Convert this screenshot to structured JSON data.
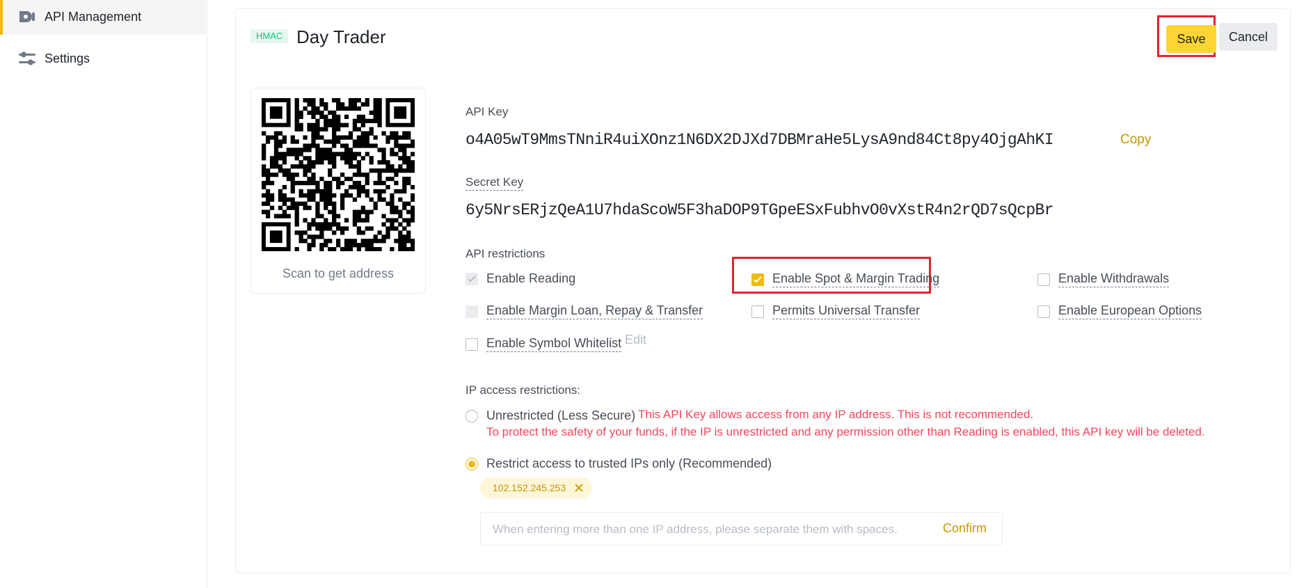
{
  "sidebar": {
    "items": [
      {
        "label": "API Management",
        "icon": "api-icon"
      },
      {
        "label": "Settings",
        "icon": "sliders-icon"
      }
    ]
  },
  "api": {
    "badge": "HMAC",
    "name": "Day Trader",
    "save_label": "Save",
    "cancel_label": "Cancel",
    "qr_caption": "Scan to get address",
    "api_key_label": "API Key",
    "api_key": "o4A05wT9MmsTNniR4uiXOnz1N6DX2DJXd7DBMraHe5LysA9nd84Ct8py4OjgAhKI",
    "copy_label": "Copy",
    "secret_key_label": "Secret Key",
    "secret_key": "6y5NrsERjzQeA1U7hdaScoW5F3haDOP9TGpeESxFubhvO0vXstR4n2rQD7sQcpBr"
  },
  "restrictions": {
    "label": "API restrictions",
    "enable_reading": "Enable Reading",
    "enable_spot_margin": "Enable Spot & Margin Trading",
    "enable_withdrawals": "Enable Withdrawals",
    "enable_margin_loan": "Enable Margin Loan, Repay & Transfer",
    "permits_universal": "Permits Universal Transfer",
    "enable_european": "Enable European Options",
    "enable_symbol_whitelist": "Enable Symbol Whitelist",
    "edit_label": "Edit"
  },
  "ip": {
    "label": "IP access restrictions:",
    "unrestricted_label": "Unrestricted (Less Secure)",
    "warning_1": "This API Key allows access from any IP address. This is not recommended.",
    "warning_2": "To protect the safety of your funds, if the IP is unrestricted and any permission other than Reading is enabled, this API key will be deleted.",
    "restrict_label": "Restrict access to trusted IPs only (Recommended)",
    "ip_chip": "102.152.245.253",
    "input_placeholder": "When entering more than one IP address, please separate them with spaces.",
    "confirm_label": "Confirm"
  },
  "colors": {
    "accent": "#f0b90b",
    "save_button": "#fcd535",
    "highlight_box": "#e2232d",
    "warning": "#f6465d",
    "hmac_badge": "#0ecb81"
  }
}
